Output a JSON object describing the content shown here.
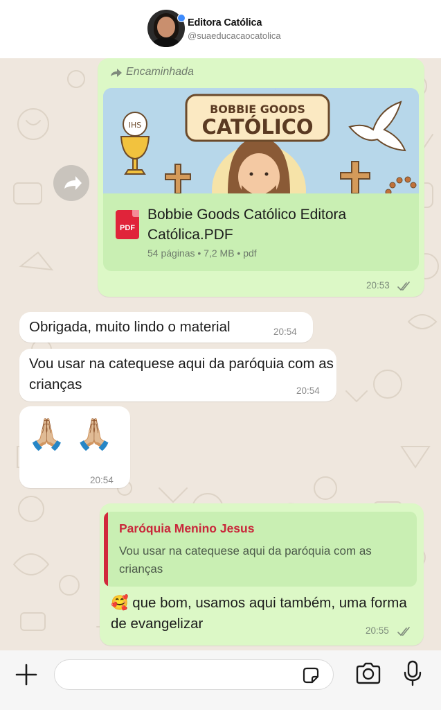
{
  "profile": {
    "name": "Editora Católica",
    "handle": "@suaeducacaocatolica"
  },
  "messages": {
    "doc": {
      "forwarded_label": "Encaminhada",
      "preview_title_line1": "BOBBIE GOODS",
      "preview_title_line2": "CATÓLICO",
      "preview_chalice_text": "IHS",
      "file_badge": "PDF",
      "file_name": "Bobbie Goods Católico Editora Católica.PDF",
      "file_meta": "54 páginas • 7,2 MB • pdf",
      "time": "20:53"
    },
    "in1": {
      "text": "Obrigada, muito lindo o material",
      "time": "20:54"
    },
    "in2": {
      "text": "Vou usar na catequese aqui da paróquia com as crianças",
      "time": "20:54"
    },
    "in3": {
      "text": "🙏🏼 🙏🏼",
      "time": "20:54"
    },
    "reply": {
      "quote_author": "Paróquia Menino Jesus",
      "quote_text": "Vou usar na catequese aqui da paróquia com as crianças",
      "text": "🥰 que bom, usamos aqui também, uma forma de evangelizar",
      "time": "20:55"
    }
  },
  "colors": {
    "outgoing_bubble": "#dcf8c6",
    "incoming_bubble": "#ffffff",
    "chat_background": "#efe7de",
    "quote_accent": "#d12a3c"
  },
  "icons": {
    "attach": "plus-icon",
    "sticker": "sticker-icon",
    "camera": "camera-icon",
    "mic": "microphone-icon",
    "share": "share-arrow-icon",
    "read": "double-check-icon"
  }
}
